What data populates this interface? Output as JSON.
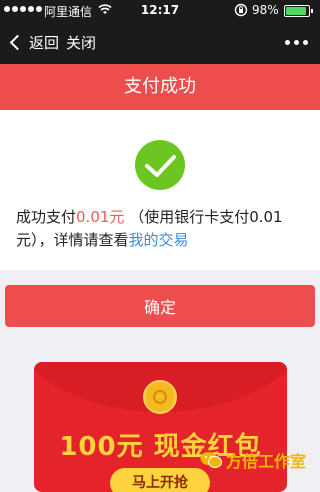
{
  "status_bar": {
    "carrier": "阿里通信",
    "time": "12:17",
    "battery_pct": "98%",
    "battery_level": 0.98
  },
  "nav": {
    "back_label": "返回",
    "close_label": "关闭"
  },
  "page": {
    "title": "支付成功"
  },
  "result": {
    "prefix": "成功支付",
    "amount": "0.01元",
    "middle": " （使用银行卡支付0.01元），详情请查看",
    "link": "我的交易"
  },
  "confirm_label": "确定",
  "promo": {
    "headline": "100元 现金红包",
    "button": "马上开抢"
  },
  "watermark": {
    "text": "方倍工作室"
  },
  "colors": {
    "accent_red": "#ee4d4d",
    "success_green": "#6cc521",
    "link_blue": "#3f8ad8",
    "gold": "#ffd33d"
  }
}
